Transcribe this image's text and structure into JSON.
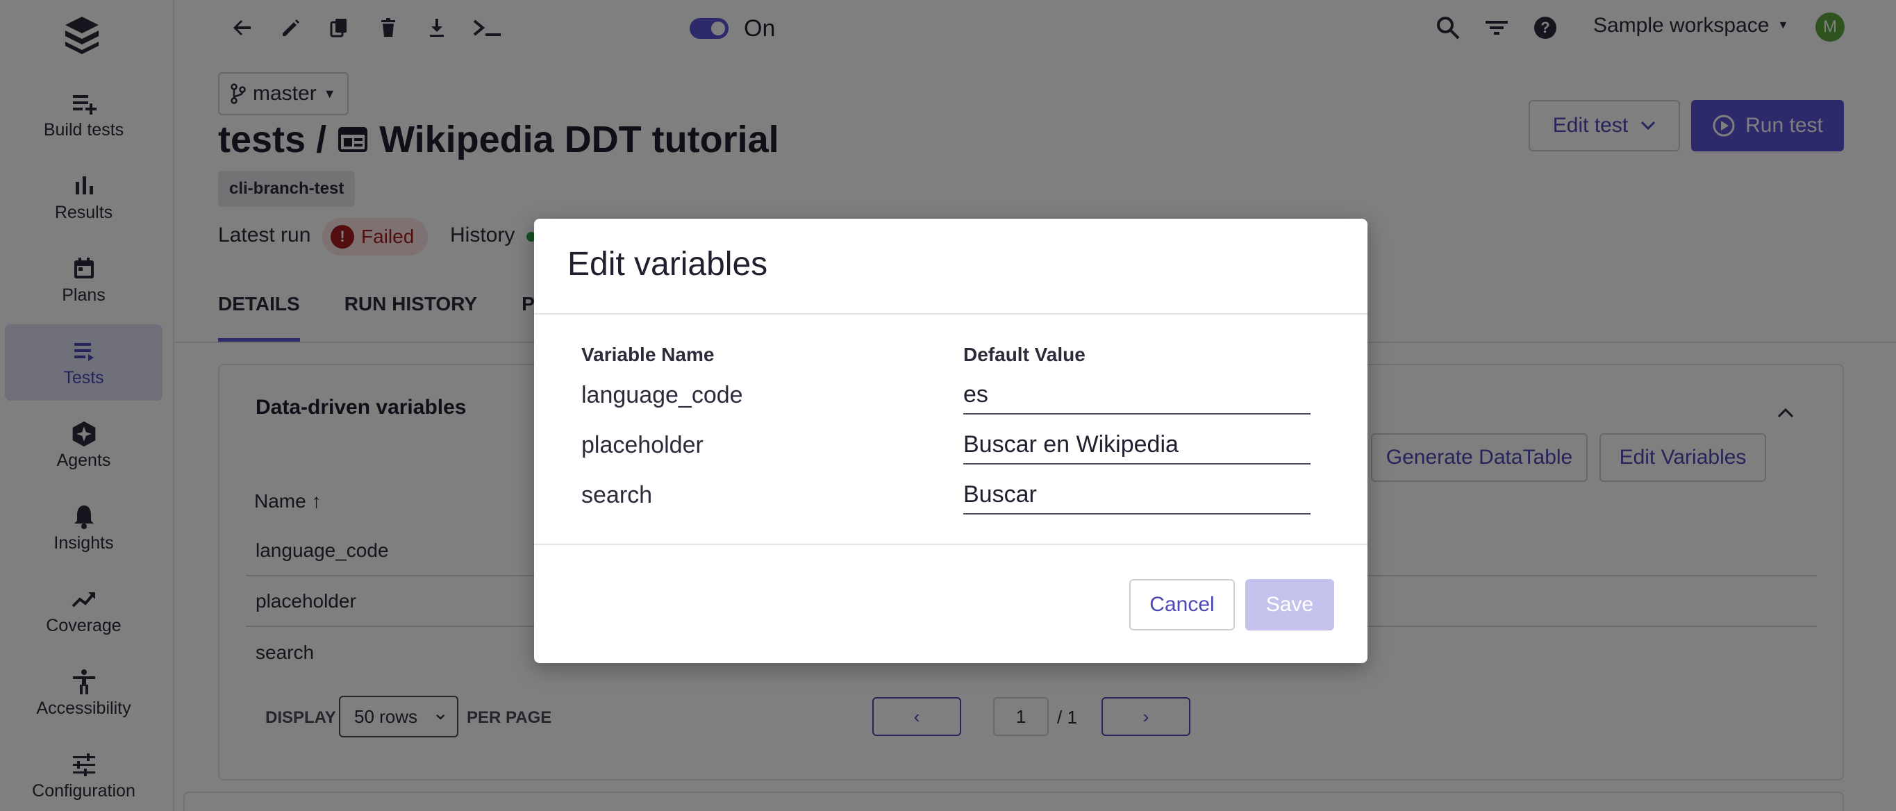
{
  "sidebar": {
    "items": [
      {
        "label": "Build tests",
        "icon": "build-tests-icon"
      },
      {
        "label": "Results",
        "icon": "bar-chart-icon"
      },
      {
        "label": "Plans",
        "icon": "calendar-icon"
      },
      {
        "label": "Tests",
        "icon": "list-icon"
      },
      {
        "label": "Agents",
        "icon": "agents-sparkle-icon"
      },
      {
        "label": "Insights",
        "icon": "bell-icon"
      },
      {
        "label": "Coverage",
        "icon": "trending-up-icon"
      },
      {
        "label": "Accessibility",
        "icon": "accessibility-icon"
      },
      {
        "label": "Configuration",
        "icon": "sliders-icon"
      }
    ],
    "active_index": 3
  },
  "toolbar": {
    "toggle_label": "On",
    "workspace": "Sample workspace",
    "avatar_initial": "M"
  },
  "header": {
    "branch": "master",
    "title_prefix": "tests /",
    "title": "Wikipedia DDT tutorial",
    "tag": "cli-branch-test",
    "latest_run_label": "Latest run",
    "status": "Failed",
    "history_label": "History",
    "edit_test": "Edit test",
    "run_test": "Run test"
  },
  "tabs": [
    "DETAILS",
    "RUN HISTORY",
    "PLANS"
  ],
  "card": {
    "title": "Data-driven variables",
    "generate_button": "Generate DataTable",
    "edit_button": "Edit Variables",
    "column_name": "Name",
    "rows": [
      "language_code",
      "placeholder",
      "search"
    ],
    "display_label": "DISPLAY",
    "rows_option": "50 rows",
    "per_page_label": "PER PAGE",
    "page": "1",
    "page_total": "/ 1"
  },
  "modal": {
    "title": "Edit variables",
    "col_name": "Variable Name",
    "col_value": "Default Value",
    "variables": [
      {
        "name": "language_code",
        "value": "es"
      },
      {
        "name": "placeholder",
        "value": "Buscar en Wikipedia"
      },
      {
        "name": "search",
        "value": "Buscar"
      }
    ],
    "cancel": "Cancel",
    "save": "Save"
  },
  "colors": {
    "accent": "#5a55d6",
    "failed": "#a41c1c",
    "avatar": "#5ea63c"
  }
}
